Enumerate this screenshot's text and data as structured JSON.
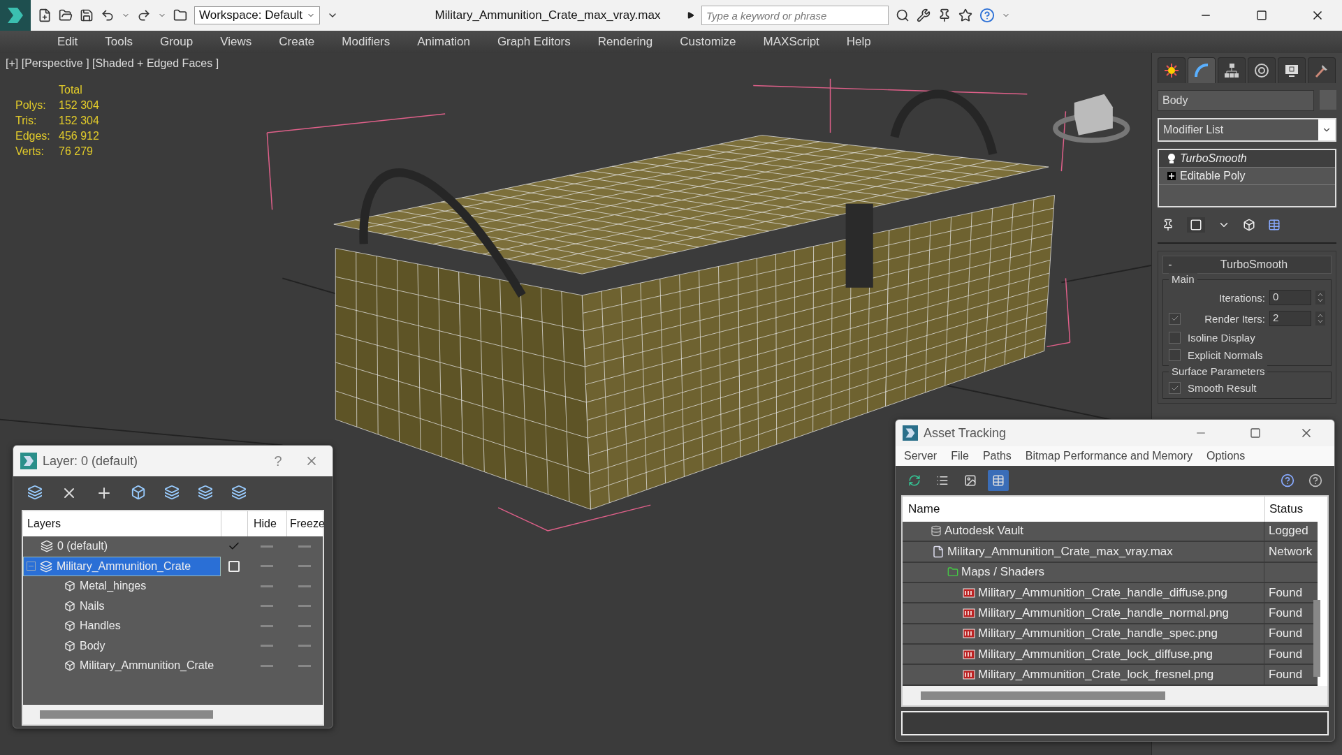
{
  "window": {
    "title": "Military_Ammunition_Crate_max_vray.max",
    "workspace": "Workspace: Default",
    "search": {
      "placeholder": "Type a keyword or phrase"
    }
  },
  "menu": [
    "Edit",
    "Tools",
    "Group",
    "Views",
    "Create",
    "Modifiers",
    "Animation",
    "Graph Editors",
    "Rendering",
    "Customize",
    "MAXScript",
    "Help"
  ],
  "viewport": {
    "label": "[+] [Perspective ] [Shaded + Edged Faces ]",
    "stats_header": "Total",
    "stats": [
      {
        "label": "Polys:",
        "value": "152 304"
      },
      {
        "label": "Tris:",
        "value": "152 304"
      },
      {
        "label": "Edges:",
        "value": "456 912"
      },
      {
        "label": "Verts:",
        "value": "76 279"
      }
    ]
  },
  "command_panel": {
    "tabs": [
      {
        "kind": "create",
        "selected": false
      },
      {
        "kind": "modify",
        "selected": true
      },
      {
        "kind": "hierarchy",
        "selected": false
      },
      {
        "kind": "motion",
        "selected": false
      },
      {
        "kind": "display",
        "selected": false
      },
      {
        "kind": "utilities",
        "selected": false
      }
    ],
    "object_name": "Body",
    "modifier_list": "Modifier List",
    "stack": [
      {
        "label": "TurboSmooth",
        "kind": "modifier",
        "selected": true
      },
      {
        "label": "Editable Poly",
        "kind": "base",
        "selected": false
      }
    ],
    "rollout": {
      "collapse": "-",
      "title": "TurboSmooth",
      "group": "Main",
      "spinners": [
        {
          "label": "Iterations:",
          "value": "0",
          "kind": "plain"
        },
        {
          "label": "Render Iters:",
          "value": "2",
          "kind": "checked",
          "checked": true
        }
      ],
      "checks": [
        {
          "label": "Isoline Display",
          "checked": false
        },
        {
          "label": "Explicit Normals",
          "checked": false
        }
      ],
      "group2": "Surface Parameters",
      "smooth": {
        "label": "Smooth Result",
        "checked": true
      }
    }
  },
  "layer_dialog": {
    "title": "Layer: 0 (default)",
    "help": "?",
    "columns": [
      "Layers",
      "Hide",
      "Freeze"
    ],
    "layers": [
      {
        "name": "0 (default)",
        "current": true,
        "selected": false,
        "expanded": false
      },
      {
        "name": "Military_Ammunition_Crate",
        "current": false,
        "selected": true,
        "expanded": true,
        "children": [
          {
            "name": "Metal_hinges"
          },
          {
            "name": "Nails"
          },
          {
            "name": "Handles"
          },
          {
            "name": "Body"
          },
          {
            "name": "Military_Ammunition_Crate"
          }
        ]
      }
    ]
  },
  "asset_tracking": {
    "title": "Asset Tracking",
    "menu": [
      "Server",
      "File",
      "Paths",
      "Bitmap Performance and Memory",
      "Options"
    ],
    "toolbar": [
      {
        "kind": "refresh",
        "selected": false
      },
      {
        "kind": "list",
        "selected": false
      },
      {
        "kind": "thumbnails",
        "selected": false
      },
      {
        "kind": "table",
        "selected": true
      }
    ],
    "columns": [
      "Name",
      "Status"
    ],
    "tree": [
      {
        "name": "Autodesk Vault",
        "status": "Logged",
        "kind": "vault",
        "children": [
          {
            "name": "Military_Ammunition_Crate_max_vray.max",
            "status": "Network",
            "kind": "max",
            "children": [
              {
                "name": "Maps / Shaders",
                "kind": "folder",
                "children": [
                  {
                    "name": "Military_Ammunition_Crate_handle_diffuse.png",
                    "status": "Found",
                    "kind": "png"
                  },
                  {
                    "name": "Military_Ammunition_Crate_handle_normal.png",
                    "status": "Found",
                    "kind": "png"
                  },
                  {
                    "name": "Military_Ammunition_Crate_handle_spec.png",
                    "status": "Found",
                    "kind": "png"
                  },
                  {
                    "name": "Military_Ammunition_Crate_lock_diffuse.png",
                    "status": "Found",
                    "kind": "png"
                  },
                  {
                    "name": "Military_Ammunition_Crate_lock_fresnel.png",
                    "status": "Found",
                    "kind": "png"
                  }
                ]
              }
            ]
          }
        ]
      }
    ]
  }
}
